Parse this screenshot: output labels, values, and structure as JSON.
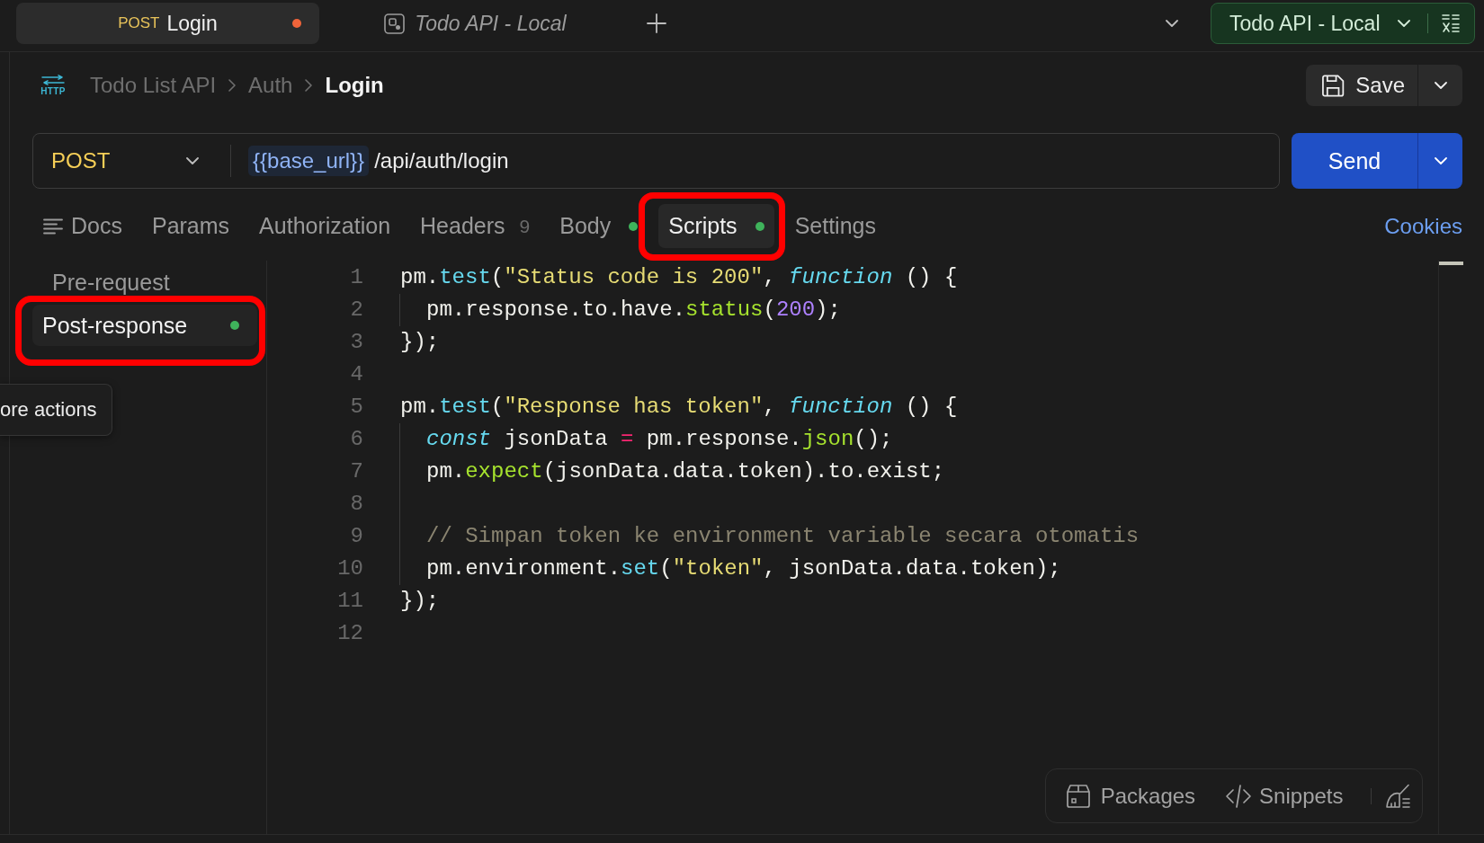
{
  "tabs": [
    {
      "kind": "request",
      "method": "POST",
      "title": "Login",
      "selected": true,
      "preview": false,
      "unsaved": true
    },
    {
      "kind": "environment",
      "title": "Todo API - Local",
      "selected": false,
      "preview": true,
      "unsaved": false
    }
  ],
  "environment_selector": {
    "label": "Todo API - Local"
  },
  "breadcrumb": {
    "protocol": "HTTP",
    "items": [
      "Todo List API",
      "Auth"
    ],
    "current": "Login"
  },
  "save_button": "Save",
  "request": {
    "method": "POST",
    "variable": "{{base_url}}",
    "path": "/api/auth/login"
  },
  "send_button": "Send",
  "request_tabs": [
    {
      "kind": "docs",
      "label": "Docs",
      "selected": false,
      "has_content": false,
      "highlighted": false
    },
    {
      "kind": "tab",
      "label": "Params",
      "selected": false,
      "has_content": false,
      "highlighted": false
    },
    {
      "kind": "tab",
      "label": "Authorization",
      "selected": false,
      "has_content": false,
      "highlighted": false
    },
    {
      "kind": "tab",
      "label": "Headers",
      "count": "9",
      "selected": false,
      "has_content": false,
      "highlighted": false
    },
    {
      "kind": "tab",
      "label": "Body",
      "selected": false,
      "has_content": true,
      "highlighted": false
    },
    {
      "kind": "tab",
      "label": "Scripts",
      "selected": true,
      "has_content": true,
      "highlighted": true
    },
    {
      "kind": "tab",
      "label": "Settings",
      "selected": false,
      "has_content": false,
      "highlighted": false
    }
  ],
  "cookies_link": "Cookies",
  "script_phases": [
    {
      "label": "Pre-request",
      "selected": false,
      "has_content": false,
      "highlighted": false
    },
    {
      "label": "Post-response",
      "selected": true,
      "has_content": true,
      "highlighted": true
    }
  ],
  "tooltip": {
    "text": "ore actions"
  },
  "code_lines": [
    {
      "number": "1",
      "indented": false,
      "tokens": [
        {
          "text": "pm.",
          "kind": "plain"
        },
        {
          "text": "test",
          "kind": "method"
        },
        {
          "text": "(",
          "kind": "plain"
        },
        {
          "text": "\"Status code is 200\"",
          "kind": "string"
        },
        {
          "text": ", ",
          "kind": "plain"
        },
        {
          "text": "function",
          "kind": "keyword"
        },
        {
          "text": " () {",
          "kind": "plain"
        }
      ]
    },
    {
      "number": "2",
      "indented": true,
      "tokens": [
        {
          "text": "pm.response.to.have.",
          "kind": "plain"
        },
        {
          "text": "status",
          "kind": "call"
        },
        {
          "text": "(",
          "kind": "plain"
        },
        {
          "text": "200",
          "kind": "number"
        },
        {
          "text": ");",
          "kind": "plain"
        }
      ]
    },
    {
      "number": "3",
      "indented": false,
      "tokens": [
        {
          "text": "});",
          "kind": "plain"
        }
      ]
    },
    {
      "number": "4",
      "indented": false
    },
    {
      "number": "5",
      "indented": false,
      "tokens": [
        {
          "text": "pm.",
          "kind": "plain"
        },
        {
          "text": "test",
          "kind": "method"
        },
        {
          "text": "(",
          "kind": "plain"
        },
        {
          "text": "\"Response has token\"",
          "kind": "string"
        },
        {
          "text": ", ",
          "kind": "plain"
        },
        {
          "text": "function",
          "kind": "keyword"
        },
        {
          "text": " () {",
          "kind": "plain"
        }
      ]
    },
    {
      "number": "6",
      "indented": true,
      "tokens": [
        {
          "text": "const",
          "kind": "keyword"
        },
        {
          "text": " jsonData ",
          "kind": "plain"
        },
        {
          "text": "=",
          "kind": "operator"
        },
        {
          "text": " pm.response.",
          "kind": "plain"
        },
        {
          "text": "json",
          "kind": "call"
        },
        {
          "text": "();",
          "kind": "plain"
        }
      ]
    },
    {
      "number": "7",
      "indented": true,
      "tokens": [
        {
          "text": "pm.",
          "kind": "plain"
        },
        {
          "text": "expect",
          "kind": "call"
        },
        {
          "text": "(jsonData.data.token).to.exist;",
          "kind": "plain"
        }
      ]
    },
    {
      "number": "8",
      "indented": true
    },
    {
      "number": "9",
      "indented": true,
      "tokens": [
        {
          "text": "// Simpan token ke environment variable secara otomatis",
          "kind": "comment"
        }
      ]
    },
    {
      "number": "10",
      "indented": true,
      "tokens": [
        {
          "text": "pm.environment.",
          "kind": "plain"
        },
        {
          "text": "set",
          "kind": "method"
        },
        {
          "text": "(",
          "kind": "plain"
        },
        {
          "text": "\"token\"",
          "kind": "string"
        },
        {
          "text": ", jsonData.data.token);",
          "kind": "plain"
        }
      ]
    },
    {
      "number": "11",
      "indented": false,
      "tokens": [
        {
          "text": "});",
          "kind": "plain"
        }
      ]
    },
    {
      "number": "12",
      "indented": false
    }
  ],
  "editor_toolbar": [
    {
      "kind": "packages",
      "label": "Packages"
    },
    {
      "kind": "snippets",
      "label": "Snippets"
    },
    {
      "kind": "clear"
    }
  ]
}
